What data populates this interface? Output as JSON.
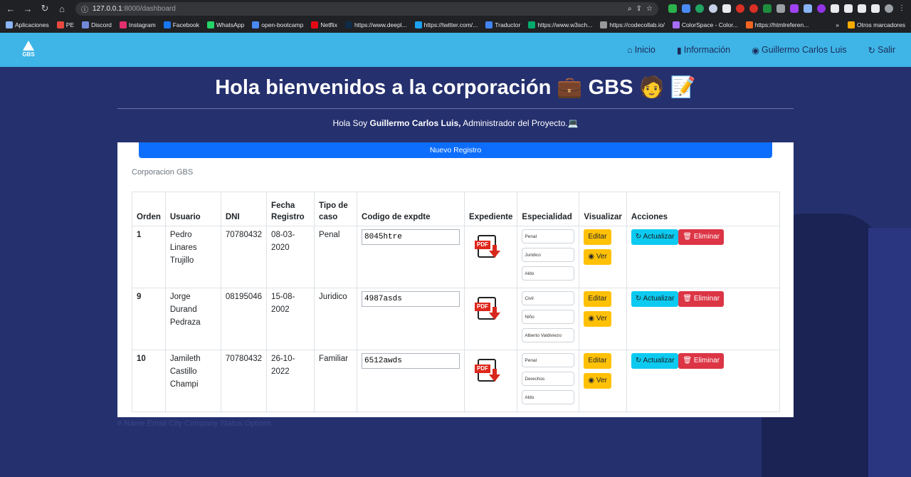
{
  "browser": {
    "url_host": "127.0.0.1",
    "url_path": ":8000/dashboard",
    "bookmarks": [
      "Aplicaciones",
      "PE",
      "Discord",
      "Instagram",
      "Facebook",
      "WhatsApp",
      "open-bootcamp",
      "Netflix",
      "https://www.deepl...",
      "https://twitter.com/...",
      "Traductor",
      "https://www.w3sch...",
      "https://codecollab.io/",
      "ColorSpace - Color...",
      "https://htmlreferen..."
    ],
    "bookmarks_more": "»",
    "other_bookmarks": "Otros marcadores"
  },
  "nav": {
    "logo_text": "GBS",
    "links": [
      "Inicio",
      "Información",
      "Guillermo Carlos Luis",
      "Salir"
    ]
  },
  "heading": "Hola bienvenidos a la corporación 💼 GBS 🧑 📝",
  "intro": {
    "prefix": "Hola Soy ",
    "name": "Guillermo Carlos Luis,",
    "suffix": " Administrador del Proyecto.💻"
  },
  "new_button": "Nuevo Registro",
  "card_title": "Corporacion GBS",
  "table": {
    "headers": [
      "Orden",
      "Usuario",
      "DNI",
      "Fecha Registro",
      "Tipo de caso",
      "Codigo de expdte",
      "Expediente",
      "Especialidad",
      "Visualizar",
      "Acciones"
    ],
    "rows": [
      {
        "orden": "1",
        "usuario": "Pedro Linares Trujillo",
        "dni": "70780432",
        "fecha": "08-03-2020",
        "tipo": "Penal",
        "codigo": "8045htre",
        "spec": [
          "Penal",
          "Juridico",
          "Aldo"
        ]
      },
      {
        "orden": "9",
        "usuario": "Jorge Durand Pedraza",
        "dni": "08195046",
        "fecha": "15-08-2002",
        "tipo": "Juridico",
        "codigo": "4987asds",
        "spec": [
          "Civil",
          "Niño",
          "Alberto Valdiviezo"
        ]
      },
      {
        "orden": "10",
        "usuario": "Jamileth Castillo Champi",
        "dni": "70780432",
        "fecha": "26-10-2022",
        "tipo": "Familiar",
        "codigo": "6512awds",
        "spec": [
          "Penal",
          "Derechos",
          "Aldo"
        ]
      }
    ]
  },
  "buttons": {
    "edit": "Editar",
    "view": "Ver",
    "update": "Actualizar",
    "delete": "Eliminar",
    "pdf": "PDF"
  },
  "footer_text": "# Name Email City Company Status Options",
  "colors": {
    "nav_bg": "#3eb5e6",
    "page_bg": "#25306e",
    "primary": "#0d6efd",
    "warning": "#ffc107",
    "info": "#0dcaf0",
    "danger": "#dc3545"
  }
}
